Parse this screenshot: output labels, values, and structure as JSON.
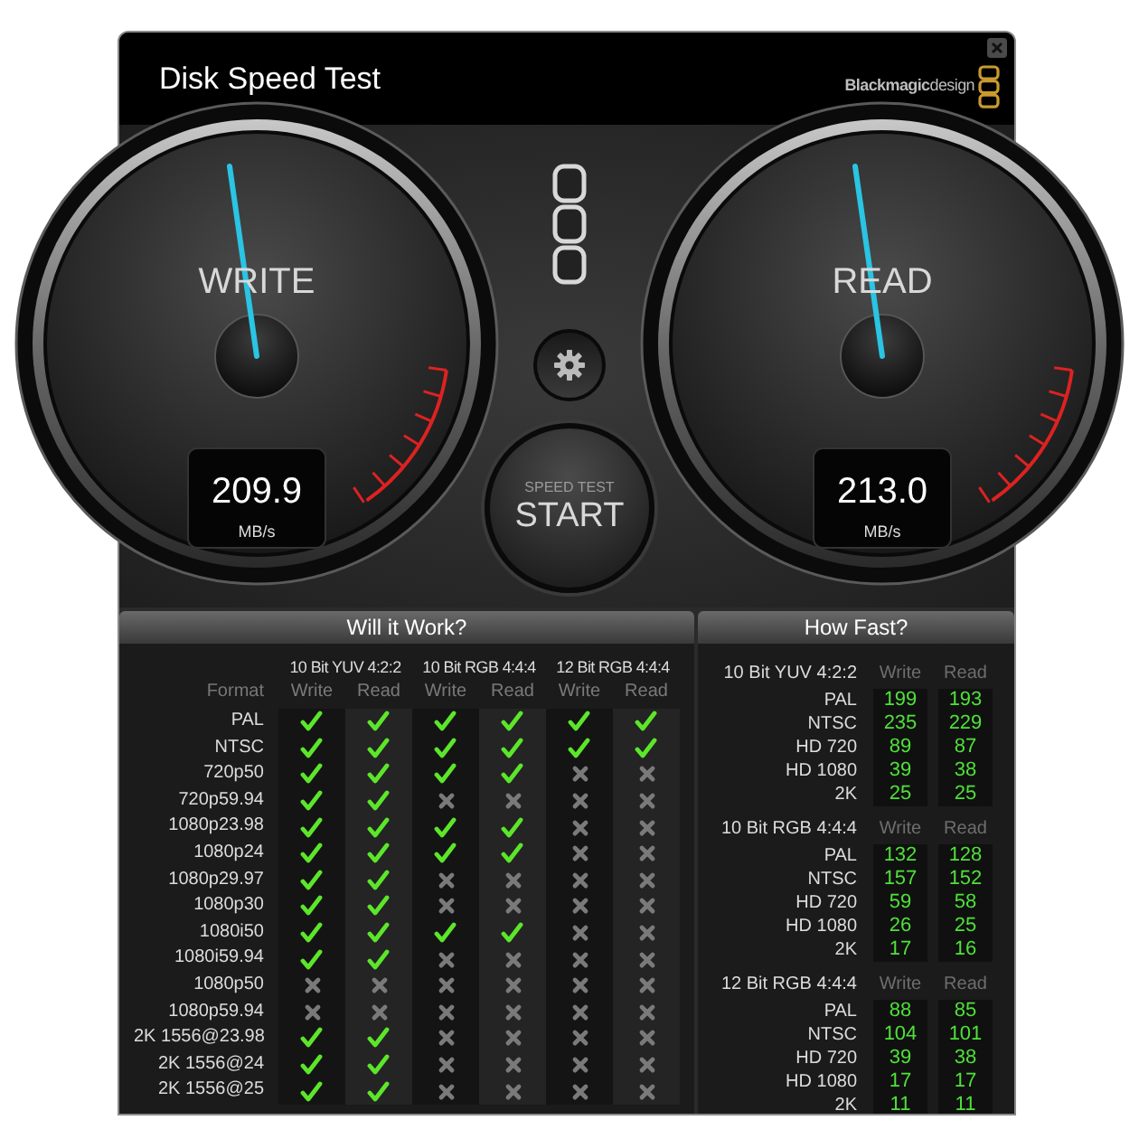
{
  "window": {
    "title": "Disk Speed Test",
    "brand": "**Blackmagic**design"
  },
  "gauges": [
    {
      "label": "WRITE",
      "value": "209.9",
      "unit": "MB/s"
    },
    {
      "label": "READ",
      "value": "213.0",
      "unit": "MB/s"
    }
  ],
  "start_button": {
    "caption": "SPEED TEST",
    "label": "START"
  },
  "will_it_work": {
    "title": "Will it Work?",
    "format_label": "Format",
    "groups": [
      {
        "name": "10 Bit YUV 4:2:2",
        "write_label": "Write",
        "read_label": "Read"
      },
      {
        "name": "10 Bit RGB 4:4:4",
        "write_label": "Write",
        "read_label": "Read"
      },
      {
        "name": "12 Bit RGB 4:4:4",
        "write_label": "Write",
        "read_label": "Read"
      }
    ],
    "rows": [
      {
        "format": "PAL",
        "results": [
          true,
          true,
          true,
          true,
          true,
          true
        ]
      },
      {
        "format": "NTSC",
        "results": [
          true,
          true,
          true,
          true,
          true,
          true
        ]
      },
      {
        "format": "720p50",
        "results": [
          true,
          true,
          true,
          true,
          false,
          false
        ]
      },
      {
        "format": "720p59.94",
        "results": [
          true,
          true,
          false,
          false,
          false,
          false
        ]
      },
      {
        "format": "1080p23.98",
        "results": [
          true,
          true,
          true,
          true,
          false,
          false
        ]
      },
      {
        "format": "1080p24",
        "results": [
          true,
          true,
          true,
          true,
          false,
          false
        ]
      },
      {
        "format": "1080p29.97",
        "results": [
          true,
          true,
          false,
          false,
          false,
          false
        ]
      },
      {
        "format": "1080p30",
        "results": [
          true,
          true,
          false,
          false,
          false,
          false
        ]
      },
      {
        "format": "1080i50",
        "results": [
          true,
          true,
          true,
          true,
          false,
          false
        ]
      },
      {
        "format": "1080i59.94",
        "results": [
          true,
          true,
          false,
          false,
          false,
          false
        ]
      },
      {
        "format": "1080p50",
        "results": [
          false,
          false,
          false,
          false,
          false,
          false
        ]
      },
      {
        "format": "1080p59.94",
        "results": [
          false,
          false,
          false,
          false,
          false,
          false
        ]
      },
      {
        "format": "2K 1556@23.98",
        "results": [
          true,
          true,
          false,
          false,
          false,
          false
        ]
      },
      {
        "format": "2K 1556@24",
        "results": [
          true,
          true,
          false,
          false,
          false,
          false
        ]
      },
      {
        "format": "2K 1556@25",
        "results": [
          true,
          true,
          false,
          false,
          false,
          false
        ]
      }
    ]
  },
  "how_fast": {
    "title": "How Fast?",
    "sections": [
      {
        "name": "10 Bit YUV 4:2:2",
        "write_label": "Write",
        "read_label": "Read",
        "rows": [
          {
            "format": "PAL",
            "write": "199",
            "read": "193"
          },
          {
            "format": "NTSC",
            "write": "235",
            "read": "229"
          },
          {
            "format": "HD 720",
            "write": "89",
            "read": "87"
          },
          {
            "format": "HD 1080",
            "write": "39",
            "read": "38"
          },
          {
            "format": "2K",
            "write": "25",
            "read": "25"
          }
        ]
      },
      {
        "name": "10 Bit RGB 4:4:4",
        "write_label": "Write",
        "read_label": "Read",
        "rows": [
          {
            "format": "PAL",
            "write": "132",
            "read": "128"
          },
          {
            "format": "NTSC",
            "write": "157",
            "read": "152"
          },
          {
            "format": "HD 720",
            "write": "59",
            "read": "58"
          },
          {
            "format": "HD 1080",
            "write": "26",
            "read": "25"
          },
          {
            "format": "2K",
            "write": "17",
            "read": "16"
          }
        ]
      },
      {
        "name": "12 Bit RGB 4:4:4",
        "write_label": "Write",
        "read_label": "Read",
        "rows": [
          {
            "format": "PAL",
            "write": "88",
            "read": "85"
          },
          {
            "format": "NTSC",
            "write": "104",
            "read": "101"
          },
          {
            "format": "HD 720",
            "write": "39",
            "read": "38"
          },
          {
            "format": "HD 1080",
            "write": "17",
            "read": "17"
          },
          {
            "format": "2K",
            "write": "11",
            "read": "11"
          }
        ]
      }
    ]
  }
}
